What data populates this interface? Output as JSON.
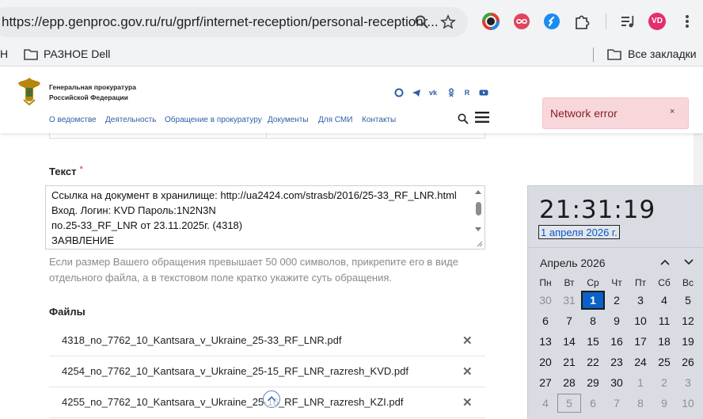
{
  "browser": {
    "url": "https://epp.genproc.gov.ru/ru/gprf/internet-reception/personal-receptionr...",
    "profile_initials": "VD",
    "bookmarks": {
      "left_fragment": "Н",
      "folder_dell": "РАЗНОЕ Dell",
      "all_bookmarks": "Все закладки"
    }
  },
  "site": {
    "org_line1": "Генеральная прокуратура",
    "org_line2": "Российской Федерации",
    "nav": [
      "О ведомстве",
      "Деятельность",
      "Обращение в прокуратуру",
      "Документы",
      "Для СМИ",
      "Контакты"
    ],
    "socials": [
      "max-icon",
      "telegram-icon",
      "vk-icon",
      "ok-icon",
      "rutube-icon",
      "youtube-icon"
    ]
  },
  "toast": {
    "message": "Network error",
    "close": "×"
  },
  "form": {
    "text_label": "Текст",
    "required_mark": "*",
    "text_lines": [
      "Ссылка на документ в хранилище: http://ua2424.com/strasb/2016/25-33_RF_LNR.html",
      "Вход. Логин: KVD Пароль:1N2N3N",
      "по.25-33_RF_LNR от 23.11.2025г. (4318)",
      "ЗАЯВЛЕНИЕ"
    ],
    "hint": "Если размер Вашего обращения превышает 50 000 символов, прикрепите его в виде отдельного файла, а в текстовом поле кратко укажите суть обращения.",
    "files_label": "Файлы",
    "files": [
      "4318_no_7762_10_Kantsara_v_Ukraine_25-33_RF_LNR.pdf",
      "4254_no_7762_10_Kantsara_v_Ukraine_25-15_RF_LNR_razresh_KVD.pdf",
      "4255_no_7762_10_Kantsara_v_Ukraine_25-16_RF_LNR_razresh_KZI.pdf"
    ],
    "delete_glyph": "✕"
  },
  "calendar": {
    "time": "21:31:19",
    "date": "1 апреля 2026 г.",
    "month": "Апрель 2026",
    "weekdays": [
      "Пн",
      "Вт",
      "Ср",
      "Чт",
      "Пт",
      "Сб",
      "Вс"
    ],
    "weeks": [
      [
        "30",
        "31",
        "1",
        "2",
        "3",
        "4",
        "5"
      ],
      [
        "6",
        "7",
        "8",
        "9",
        "10",
        "11",
        "12"
      ],
      [
        "13",
        "14",
        "15",
        "16",
        "17",
        "18",
        "19"
      ],
      [
        "20",
        "21",
        "22",
        "23",
        "24",
        "25",
        "26"
      ],
      [
        "27",
        "28",
        "29",
        "30",
        "1",
        "2",
        "3"
      ],
      [
        "4",
        "5",
        "6",
        "7",
        "8",
        "9",
        "10"
      ]
    ],
    "today_label": "1",
    "accent": "#0b60c9"
  }
}
